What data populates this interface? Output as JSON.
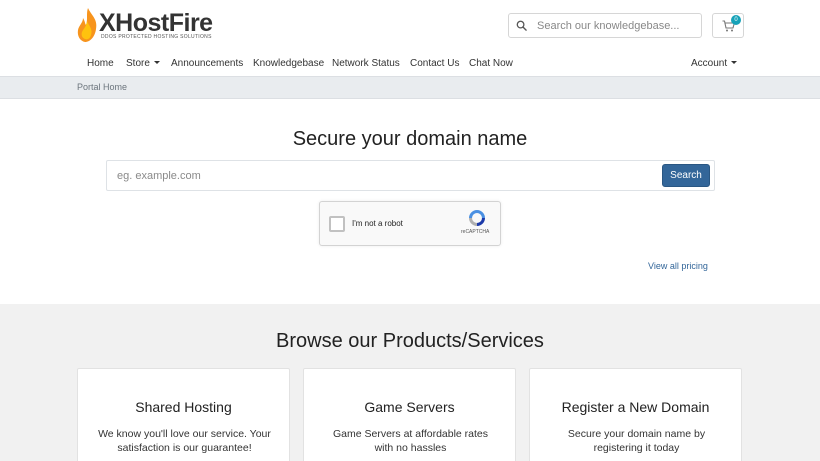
{
  "brand": {
    "name": "XHostFire",
    "tagline": "DDOS PROTECTED HOSTING SOLUTIONS"
  },
  "header": {
    "search_placeholder": "Search our knowledgebase...",
    "cart_count": "0"
  },
  "nav": {
    "items": [
      {
        "label": "Home"
      },
      {
        "label": "Store"
      },
      {
        "label": "Announcements"
      },
      {
        "label": "Knowledgebase"
      },
      {
        "label": "Network Status"
      },
      {
        "label": "Contact Us"
      },
      {
        "label": "Chat Now"
      }
    ],
    "account_label": "Account"
  },
  "breadcrumb": "Portal Home",
  "domain": {
    "title": "Secure your domain name",
    "placeholder": "eg. example.com",
    "search_label": "Search",
    "captcha_label": "I'm not a robot",
    "captcha_brand": "reCAPTCHA",
    "view_pricing": "View all pricing"
  },
  "products": {
    "title": "Browse our Products/Services",
    "cards": [
      {
        "title": "Shared Hosting",
        "desc": "We know you'll love our service. Your satisfaction is our guarantee!"
      },
      {
        "title": "Game Servers",
        "desc": "Game Servers at affordable rates with no hassles"
      },
      {
        "title": "Register a New Domain",
        "desc": "Secure your domain name by registering it today"
      }
    ]
  },
  "colors": {
    "primary": "#336699",
    "badge": "#17a2b8",
    "flame_orange": "#f7941d",
    "flame_yellow": "#ffc20e"
  }
}
